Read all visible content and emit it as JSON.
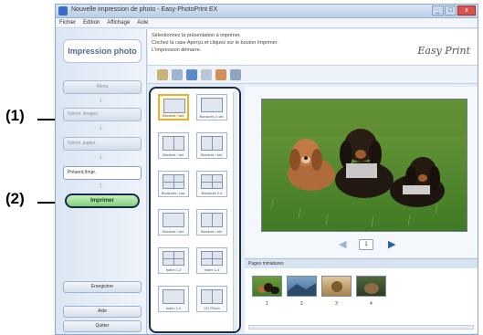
{
  "callouts": {
    "one": "(1)",
    "two": "(2)"
  },
  "window": {
    "title": "Nouvelle impression de photo - Easy-PhotoPrint EX",
    "buttons": {
      "minimize": "_",
      "maximize": "□",
      "close": "x"
    }
  },
  "menu": [
    "Fichier",
    "Edition",
    "Affichage",
    "Aide"
  ],
  "left_pane": {
    "title": "Impression photo",
    "steps": [
      {
        "label": "Menu"
      },
      {
        "label": "Sélect. images"
      },
      {
        "label": "Sélect. papier"
      },
      {
        "label": "Présent./Impr."
      }
    ],
    "print_button": "Imprimer",
    "save_button": "Enregistrer",
    "help_button": "Aide",
    "quit_button": "Quitter"
  },
  "instructions": {
    "line1": "Sélectionnez la présentation à imprimer.",
    "line2": "Cochez la case Aperçu et cliquez sur le bouton Imprimer.",
    "line3": "L'impression démarre."
  },
  "brand": "Easy Print",
  "layouts": [
    {
      "label": "Bordure / sel.",
      "selected": true,
      "style": "single"
    },
    {
      "label": "Bordures 1-sel.",
      "selected": false,
      "style": "single"
    },
    {
      "label": "Bordure / sel.",
      "selected": false,
      "style": "split"
    },
    {
      "label": "Bordure / sel.",
      "selected": false,
      "style": "split"
    },
    {
      "label": "Bordures / par.",
      "selected": false,
      "style": "grid"
    },
    {
      "label": "Bordures 2-4",
      "selected": false,
      "style": "grid"
    },
    {
      "label": "Bordure / sel.",
      "selected": false,
      "style": "single"
    },
    {
      "label": "Bordure / sel.",
      "selected": false,
      "style": "split"
    },
    {
      "label": "Index 1-2",
      "selected": false,
      "style": "grid"
    },
    {
      "label": "Index 1-4",
      "selected": false,
      "style": "grid"
    },
    {
      "label": "Index 1-2",
      "selected": false,
      "style": "single"
    },
    {
      "label": "CD Photo",
      "selected": false,
      "style": "split"
    }
  ],
  "preview": {
    "page_number": "1"
  },
  "pages_header": "Pages miniatures",
  "thumbnails": [
    {
      "number": "1"
    },
    {
      "number": "2"
    },
    {
      "number": "3"
    },
    {
      "number": "4"
    }
  ],
  "colors": {
    "accent": "#2b5fb5",
    "print_button": "#7fd07a",
    "selected_layout": "#e1b23a"
  }
}
